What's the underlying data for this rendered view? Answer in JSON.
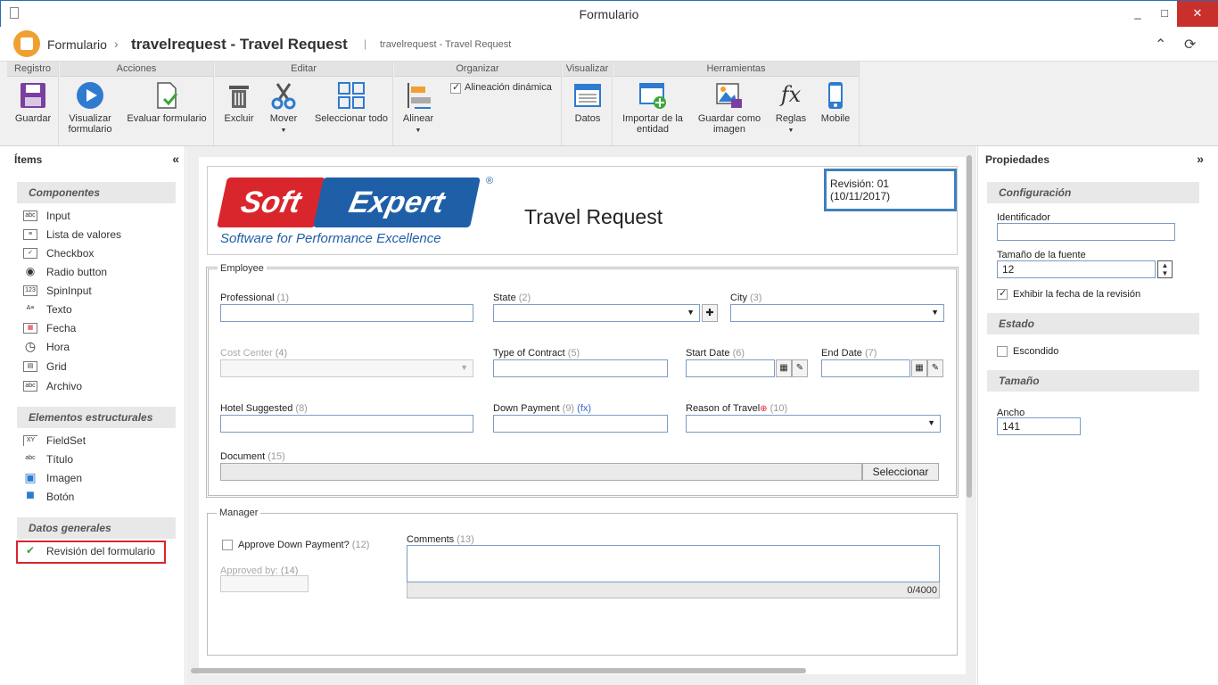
{
  "window": {
    "title": "Formulario",
    "min": "_",
    "max": "□",
    "close": "✕"
  },
  "header": {
    "crumb_root": "Formulario",
    "separator": "›",
    "crumb_title": "travelrequest - Travel Request",
    "divider": "|",
    "crumb_sub": "travelrequest - Travel Request",
    "collapse_icon": "⌃",
    "refresh_icon": "⟳"
  },
  "ribbon": {
    "groups": [
      {
        "label": "Registro"
      },
      {
        "label": "Acciones"
      },
      {
        "label": "Editar"
      },
      {
        "label": "Organizar"
      },
      {
        "label": "Visualizar"
      },
      {
        "label": "Herramientas"
      }
    ],
    "buttons": {
      "save": "Guardar",
      "preview_1": "Visualizar",
      "preview_2": "formulario",
      "evaluate": "Evaluar formulario",
      "delete": "Excluir",
      "move": "Mover",
      "select_all": "Seleccionar todo",
      "align": "Alinear",
      "dynamic_align": "Alineación dinámica",
      "data": "Datos",
      "import_1": "Importar de la",
      "import_2": "entidad",
      "save_image_1": "Guardar como",
      "save_image_2": "imagen",
      "rules": "Reglas",
      "mobile": "Mobile"
    },
    "caret": "▼"
  },
  "left": {
    "title": "Ítems",
    "collapse": "«",
    "sections": {
      "components": "Componentes",
      "structural": "Elementos estructurales",
      "general": "Datos generales"
    },
    "components": [
      {
        "icon": "abc",
        "label": "Input"
      },
      {
        "icon": "≡",
        "label": "Lista de valores"
      },
      {
        "icon": "✓",
        "label": "Checkbox"
      },
      {
        "icon": "◉",
        "label": "Radio button"
      },
      {
        "icon": "123",
        "label": "SpinInput"
      },
      {
        "icon": "A≡",
        "label": "Texto"
      },
      {
        "icon": "▦",
        "label": "Fecha"
      },
      {
        "icon": "◷",
        "label": "Hora"
      },
      {
        "icon": "▤",
        "label": "Grid"
      },
      {
        "icon": "abc",
        "label": "Archivo"
      }
    ],
    "structural": [
      {
        "icon": "XY",
        "label": "FieldSet"
      },
      {
        "icon": "abc",
        "label": "Título"
      },
      {
        "icon": "▣",
        "label": "Imagen"
      },
      {
        "icon": "■",
        "label": "Botón"
      }
    ],
    "general": [
      {
        "icon": "✔",
        "label": "Revisión del formulario"
      }
    ]
  },
  "form": {
    "logo_soft": "Soft",
    "logo_expert": "Expert",
    "logo_reg": "®",
    "logo_tagline": "Software for Performance Excellence",
    "title": "Travel Request",
    "revision": "Revisión: 01 (10/11/2017)",
    "employee": {
      "legend": "Employee",
      "professional": {
        "label": "Professional",
        "num": "(1)"
      },
      "state": {
        "label": "State",
        "num": "(2)",
        "plus": "✚"
      },
      "city": {
        "label": "City",
        "num": "(3)"
      },
      "cost_center": {
        "label": "Cost Center",
        "num": "(4)"
      },
      "type_contract": {
        "label": "Type of Contract",
        "num": "(5)"
      },
      "start_date": {
        "label": "Start Date",
        "num": "(6)"
      },
      "end_date": {
        "label": "End Date",
        "num": "(7)"
      },
      "hotel": {
        "label": "Hotel Suggested",
        "num": "(8)"
      },
      "down_payment": {
        "label": "Down Payment",
        "num": "(9)",
        "fx": "(fx)"
      },
      "reason": {
        "label": "Reason of Travel",
        "num": "(10)",
        "req": "⊕"
      },
      "document": {
        "label": "Document",
        "num": "(15)",
        "button": "Seleccionar"
      }
    },
    "manager": {
      "legend": "Manager",
      "approve": {
        "label": "Approve Down Payment?",
        "num": "(12)"
      },
      "approved_by": {
        "label": "Approved by:",
        "num": "(14)"
      },
      "comments": {
        "label": "Comments",
        "num": "(13)",
        "counter": "0/4000"
      }
    }
  },
  "right": {
    "title": "Propiedades",
    "expand": "»",
    "sections": {
      "config": "Configuración",
      "estado": "Estado",
      "size": "Tamaño"
    },
    "identifier_label": "Identificador",
    "identifier_value": "",
    "font_size_label": "Tamaño de la fuente",
    "font_size_value": "12",
    "show_date_label": "Exhibir la fecha de la revisión",
    "hidden_label": "Escondido",
    "width_label": "Ancho",
    "width_value": "141"
  },
  "colors": {
    "accent": "#1f5fa8",
    "brand_red": "#d9262c",
    "logo_orange": "#f0a030"
  }
}
